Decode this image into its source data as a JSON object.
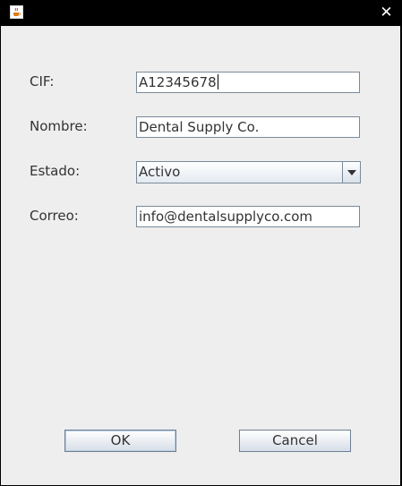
{
  "window": {
    "icon": "java-coffee-icon",
    "close_glyph": "✕"
  },
  "form": {
    "cif_label": "CIF:",
    "cif_value": "A12345678",
    "nombre_label": "Nombre:",
    "nombre_value": "Dental Supply Co.",
    "estado_label": "Estado:",
    "estado_value": "Activo",
    "correo_label": "Correo:",
    "correo_value": "info@dentalsupplyco.com"
  },
  "buttons": {
    "ok_label": "OK",
    "cancel_label": "Cancel"
  }
}
